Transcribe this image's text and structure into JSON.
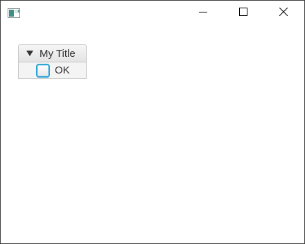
{
  "window": {
    "controls": {
      "minimize_icon": "minimize-icon",
      "maximize_icon": "maximize-icon",
      "close_icon": "close-icon"
    },
    "app_icon": "java-app-icon"
  },
  "titled_pane": {
    "title": "My Title",
    "expanded": true,
    "arrow_icon": "triangle-down-icon",
    "checkbox": {
      "label": "OK",
      "checked": false,
      "focused": true
    }
  },
  "colors": {
    "focus_ring": "#2da3d6",
    "header_border": "#c5c5c5",
    "text": "#333333"
  }
}
